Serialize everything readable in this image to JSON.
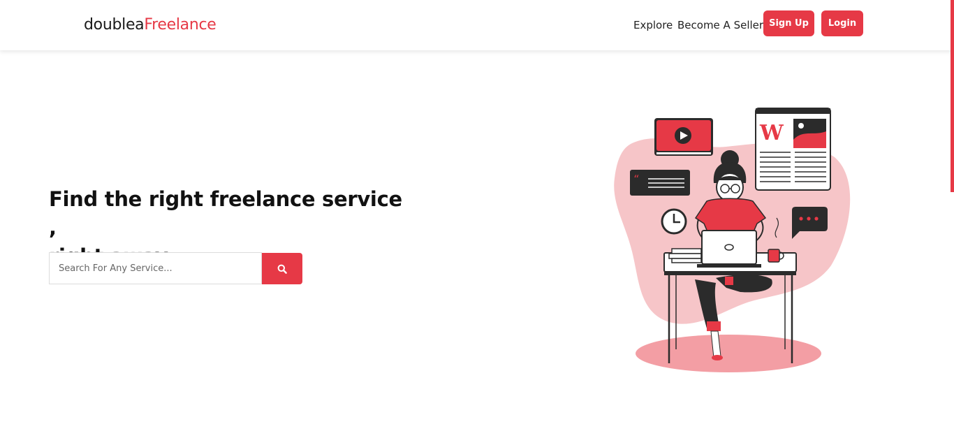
{
  "header": {
    "logo_part1": "doublea",
    "logo_part2": "Freelance",
    "nav": {
      "explore": "Explore",
      "become_seller": "Become A Seller",
      "sign_up": "Sign Up",
      "login": "Login"
    }
  },
  "hero": {
    "title_line1": "Find the right freelance service ,",
    "title_line2": "right away",
    "search": {
      "placeholder": "Search For Any Service...",
      "value": ""
    }
  },
  "illustration": {
    "newspaper_letter": "W"
  },
  "icons": {
    "search_button": "search-icon",
    "illustration": "freelancer-working-illustration"
  },
  "colors": {
    "accent": "#e63946",
    "blob": "#f6c5c8",
    "floor": "#f39ea4",
    "dark": "#2b2b2b"
  }
}
